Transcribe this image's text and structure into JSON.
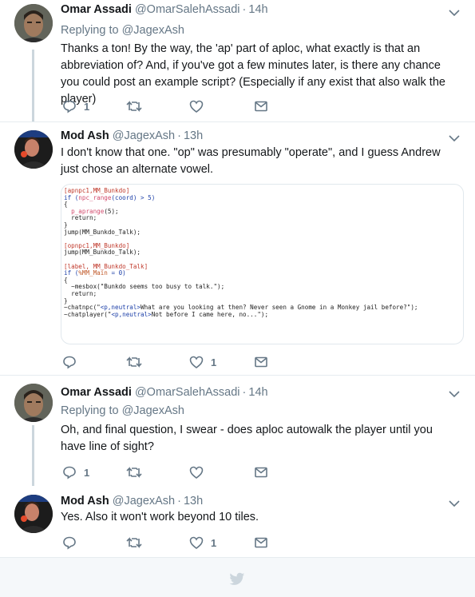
{
  "tweets": [
    {
      "name": "Omar Assadi",
      "handle": "@OmarSalehAssadi",
      "time": "14h",
      "replying_prefix": "Replying to ",
      "replying_to": "@JagexAsh",
      "text": "Thanks a ton! By the way, the 'ap' part of aploc, what exactly is that an abbreviation of? And, if you've got a few minutes later, is there any chance you could post an example script? (Especially if any exist that also walk the player)",
      "reply_count": "1",
      "retweet_count": "",
      "like_count": ""
    },
    {
      "name": "Mod Ash",
      "handle": "@JagexAsh",
      "time": "13h",
      "text": "I don't know that one. \"op\" was presumably \"operate\", and I guess Andrew just chose an alternate vowel.",
      "reply_count": "",
      "retweet_count": "",
      "like_count": "1",
      "code_lines": [
        "[apnpc1,MM_Bunkdo]",
        "if (npc_range(coord) > 5)",
        "{",
        "  p_aprange(5);",
        "  return;",
        "}",
        "jump(MM_Bunkdo_Talk);",
        "",
        "[opnpc1,MM_Bunkdo]",
        "jump(MM_Bunkdo_Talk);",
        "",
        "[label, MM_Bunkdo_Talk]",
        "if (%MM_Main = 0)",
        "{",
        "  ~mesbox(\"Bunkdo seems too busy to talk.\");",
        "  return;",
        "}",
        "~chatnpc(\"<p,neutral>What are you looking at then? Never seen a Gnome in a Monkey jail before?\");",
        "~chatplayer(\"<p,neutral>Not before I came here, no...\");"
      ]
    },
    {
      "name": "Omar Assadi",
      "handle": "@OmarSalehAssadi",
      "time": "14h",
      "replying_prefix": "Replying to ",
      "replying_to": "@JagexAsh",
      "text": "Oh, and final question, I swear - does aploc autowalk the player until you have line of sight?",
      "reply_count": "1",
      "retweet_count": "",
      "like_count": ""
    },
    {
      "name": "Mod Ash",
      "handle": "@JagexAsh",
      "time": "13h",
      "text": "Yes. Also it won't work beyond 10 tiles.",
      "reply_count": "",
      "retweet_count": "",
      "like_count": "1"
    }
  ],
  "separator": "·",
  "colors": {
    "text": "#14171a",
    "muted": "#657786",
    "divider": "#e6ecf0",
    "thread_line": "#ccd6dd",
    "brand": "#1da1f2"
  },
  "icons": [
    "reply-icon",
    "retweet-icon",
    "like-icon",
    "direct-message-icon",
    "chevron-down-icon",
    "twitter-bird-icon"
  ]
}
